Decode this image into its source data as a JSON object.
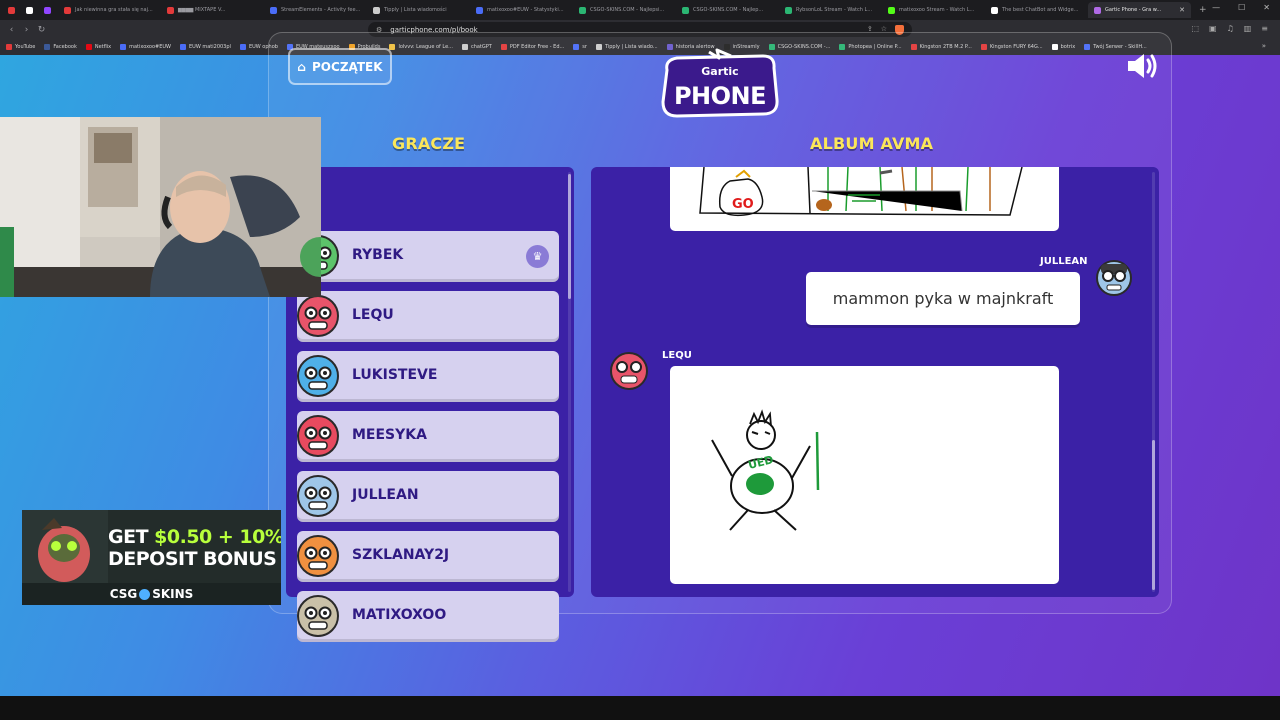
{
  "browser": {
    "tabs": [
      {
        "label": "",
        "color": "#e33a3a"
      },
      {
        "label": "",
        "color": "#ffffff"
      },
      {
        "label": "",
        "color": "#9146ff"
      },
      {
        "label": "Jak niewinna gra stała się naj...",
        "color": "#e33a3a"
      },
      {
        "label": "▆▆▆▆ MIXTAPE V...",
        "color": "#e33a3a"
      },
      {
        "label": "StreamElements - Activity fee...",
        "color": "#4a6cf7"
      },
      {
        "label": "Tipply | Lista wiadomości",
        "color": "#cccccc"
      },
      {
        "label": "matixoxoo#EUW - Statystyki...",
        "color": "#4a6cf7"
      },
      {
        "label": "CSGO-SKINS.COM - Najlepsi...",
        "color": "#2bb673"
      },
      {
        "label": "CSGO-SKINS.COM - Najlep...",
        "color": "#2bb673"
      },
      {
        "label": "RybsonLoL Stream - Watch L...",
        "color": "#2bb673"
      },
      {
        "label": "matixoxoo Stream - Watch L...",
        "color": "#53fc18"
      },
      {
        "label": "The best ChatBot and Widge...",
        "color": "#ffffff"
      },
      {
        "label": "Gartic Phone - Gra w...",
        "color": "#b06ae6"
      }
    ],
    "url": "garticphone.com/pl/book",
    "bookmarks": [
      {
        "label": "YouTube",
        "color": "#e33a3a"
      },
      {
        "label": "Facebook",
        "color": "#3b5998"
      },
      {
        "label": "Netflix",
        "color": "#e50914"
      },
      {
        "label": "matixoxoo#EUW",
        "color": "#4a6cf7"
      },
      {
        "label": "EUW mati2003pl",
        "color": "#4a6cf7"
      },
      {
        "label": "EUW ophob",
        "color": "#4a6cf7"
      },
      {
        "label": "EUW mateuszxoo",
        "color": "#4a6cf7"
      },
      {
        "label": "Probuilds",
        "color": "#f0a020"
      },
      {
        "label": "lolvvv: League of Le...",
        "color": "#f0c040"
      },
      {
        "label": "chatGPT",
        "color": "#cccccc"
      },
      {
        "label": "PDF Editor Free - Ed...",
        "color": "#e33a3a"
      },
      {
        "label": "sr",
        "color": "#4a6cf7"
      },
      {
        "label": "Tipply | Lista wiado...",
        "color": "#cccccc"
      },
      {
        "label": "historia alertow",
        "color": "#6a5acd"
      },
      {
        "label": "inStreamly",
        "color": "#222222"
      },
      {
        "label": "CSGO-SKINS.COM -...",
        "color": "#2bb673"
      },
      {
        "label": "Photopea | Online P...",
        "color": "#2bb673"
      },
      {
        "label": "Kingston 2TB M.2 P...",
        "color": "#e33a3a"
      },
      {
        "label": "Kingston FURY 64G...",
        "color": "#e33a3a"
      },
      {
        "label": "botrix",
        "color": "#ffffff"
      },
      {
        "label": "Twój Serwer - SkillH...",
        "color": "#4a6cf7"
      }
    ]
  },
  "game": {
    "start_button_label": "POCZĄTEK",
    "logo_top": "Gartic",
    "logo_bottom": "PHONE",
    "players_heading": "GRACZE",
    "album_heading": "ALBUM AVMA",
    "players": [
      {
        "name": "RYBEK",
        "host": true,
        "avatar_color": "#5cc46a"
      },
      {
        "name": "LEQU",
        "host": false,
        "avatar_color": "#e8546a"
      },
      {
        "name": "LUKISTEVE",
        "host": false,
        "avatar_color": "#4fb0e8"
      },
      {
        "name": "MEESYKA",
        "host": false,
        "avatar_color": "#e84a5f"
      },
      {
        "name": "JULLEAN",
        "host": false,
        "avatar_color": "#9ec6e8"
      },
      {
        "name": "SZKLANAY2J",
        "host": false,
        "avatar_color": "#f09040"
      },
      {
        "name": "MATIXOXOO",
        "host": false,
        "avatar_color": "#c9c0a8"
      }
    ],
    "album": {
      "guess_author": "JULLEAN",
      "guess_text": "mammon pyka w majnkraft",
      "drawing_author": "LEQU",
      "drawing_money_text": "GO",
      "drawing_badge_text": "UED"
    }
  },
  "ad": {
    "line1_prefix": "GET ",
    "line1_highlight": "$0.50 + 10%",
    "line2": "DEPOSIT BONUS",
    "brand_left": "CSG",
    "brand_right": "SKINS"
  }
}
